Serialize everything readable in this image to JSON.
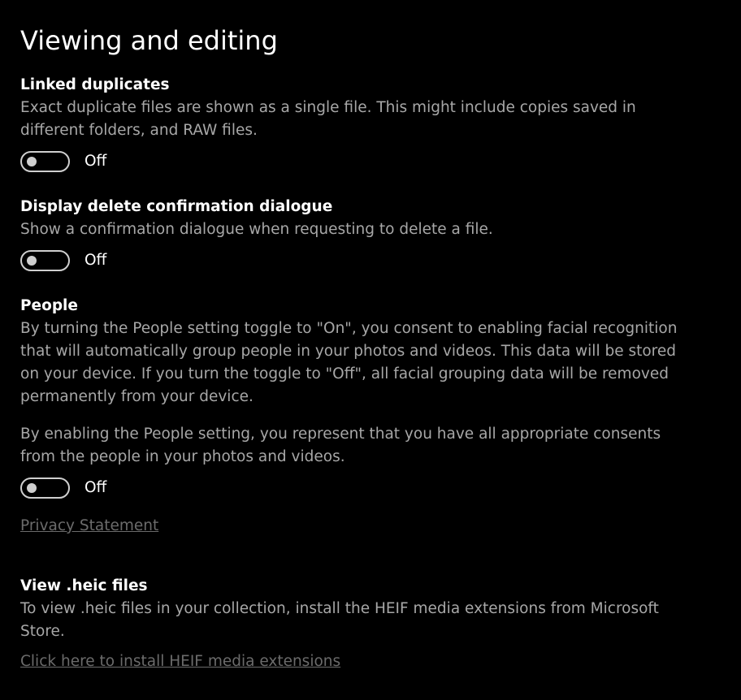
{
  "page": {
    "title": "Viewing and editing"
  },
  "settings": {
    "linked_duplicates": {
      "title": "Linked duplicates",
      "description_lines": [
        "Exact duplicate files are shown as a single file. This might include copies saved in",
        "different folders, and RAW files."
      ],
      "toggle_state": "Off"
    },
    "delete_confirmation": {
      "title": "Display delete confirmation dialogue",
      "description_lines": [
        "Show a confirmation dialogue when requesting to delete a file."
      ],
      "toggle_state": "Off"
    },
    "people": {
      "title": "People",
      "description_lines": [
        "By turning the People setting toggle to \"On\", you consent to enabling facial recognition",
        "that will automatically group people in your photos and videos. This data will be stored",
        "on your device. If you turn the toggle to \"Off\", all facial grouping data will be removed",
        "permanently from your device."
      ],
      "consent_lines": [
        "By enabling the People setting, you represent that you have all appropriate consents",
        "from the people in your photos and videos."
      ],
      "toggle_state": "Off",
      "privacy_link": "Privacy Statement"
    },
    "heic": {
      "title": "View .heic files",
      "description_lines": [
        "To view .heic files in your collection, install the HEIF media extensions from Microsoft",
        "Store."
      ],
      "install_link": "Click here to install HEIF media extensions"
    }
  },
  "colors": {
    "background": "#000000",
    "primary_text": "#ffffff",
    "secondary_text": "#a7a7a7",
    "disabled_link": "#6b6b6b",
    "toggle_outline": "#cfcfcf"
  }
}
